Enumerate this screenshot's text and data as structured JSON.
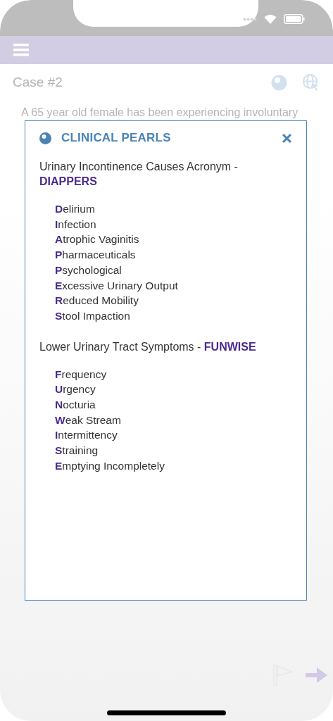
{
  "case": {
    "title": "Case #2"
  },
  "background_text": [
    "A 65 year old female has been experiencing involuntary"
  ],
  "modal": {
    "title": "CLINICAL PEARLS",
    "sections": [
      {
        "heading": "Urinary Incontinence Causes Acronym - **DIAPPERS**",
        "items": [
          "**D**elirium",
          "**I**nfection",
          "**A**trophic Vaginitis",
          "**P**harmaceuticals",
          "**P**sychological",
          "**E**xcessive Urinary Output",
          "**R**educed Mobility",
          "**S**tool Impaction"
        ]
      },
      {
        "heading": "Lower Urinary Tract Symptoms - **FUNWISE**",
        "items": [
          "**F**requency",
          "**U**rgency",
          "**N**octuria",
          "**W**eak Stream",
          "**I**ntermittency",
          "**S**training",
          "**E**mptying Incompletely"
        ]
      }
    ]
  }
}
